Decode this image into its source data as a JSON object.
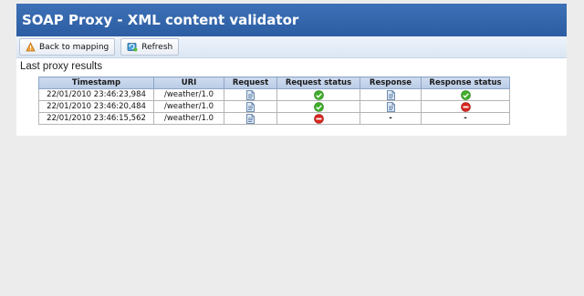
{
  "app": {
    "title": "SOAP Proxy - XML content validator"
  },
  "toolbar": {
    "back_label": "Back to mapping",
    "refresh_label": "Refresh"
  },
  "section": {
    "title": "Last proxy results"
  },
  "table": {
    "headers": [
      "Timestamp",
      "URI",
      "Request",
      "Request status",
      "Response",
      "Response status"
    ],
    "rows": [
      {
        "timestamp": "22/01/2010 23:46:23,984",
        "uri": "/weather/1.0",
        "request": "document-icon",
        "request_status": "ok",
        "response": "document-icon",
        "response_status": "ok"
      },
      {
        "timestamp": "22/01/2010 23:46:20,484",
        "uri": "/weather/1.0",
        "request": "document-icon",
        "request_status": "ok",
        "response": "document-icon",
        "response_status": "error"
      },
      {
        "timestamp": "22/01/2010 23:46:15,562",
        "uri": "/weather/1.0",
        "request": "document-icon",
        "request_status": "error",
        "response": "-",
        "response_status": "-"
      }
    ]
  },
  "colors": {
    "titlebar": "#2c5da3",
    "ok": "#3fae2a",
    "error": "#d8261e"
  }
}
